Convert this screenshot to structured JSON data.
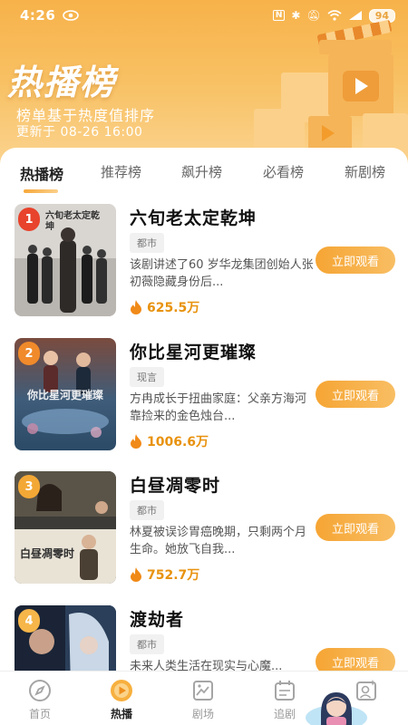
{
  "status_bar": {
    "time": "4:26",
    "battery": "94"
  },
  "header": {
    "title": "热播榜",
    "subtitle": "榜单基于热度值排序",
    "updated": "更新于 08-26 16:00"
  },
  "tabs": [
    {
      "label": "热播榜",
      "active": true
    },
    {
      "label": "推荐榜",
      "active": false
    },
    {
      "label": "飙升榜",
      "active": false
    },
    {
      "label": "必看榜",
      "active": false
    },
    {
      "label": "新剧榜",
      "active": false
    }
  ],
  "items": [
    {
      "rank": "1",
      "title": "六旬老太定乾坤",
      "tag": "都市",
      "desc": "该剧讲述了60 岁华龙集团创始人张初薇隐藏身份后...",
      "heat": "625.5万",
      "button": "立即观看",
      "poster_text": "六旬老太定乾坤",
      "badge_color": "#e8432c"
    },
    {
      "rank": "2",
      "title": "你比星河更璀璨",
      "tag": "现言",
      "desc": "方冉成长于扭曲家庭：父亲方海河靠捡来的金色烛台...",
      "heat": "1006.6万",
      "button": "立即观看",
      "poster_text": "你比星河更璀璨",
      "badge_color": "#f08a2b"
    },
    {
      "rank": "3",
      "title": "白昼凋零时",
      "tag": "都市",
      "desc": "林夏被误诊胃癌晚期，只剩两个月生命。她放飞自我...",
      "heat": "752.7万",
      "button": "立即观看",
      "poster_text": "白昼凋零时",
      "badge_color": "#f3a836"
    },
    {
      "rank": "4",
      "title": "渡劫者",
      "tag": "都市",
      "desc": "未来人类生活在现实与心魔...",
      "heat": "",
      "button": "立即观看",
      "poster_text": "",
      "badge_color": "#f6b64a"
    }
  ],
  "bottom_nav": [
    {
      "label": "首页",
      "icon": "compass-icon",
      "active": false
    },
    {
      "label": "热播",
      "icon": "play-circle-icon",
      "active": true
    },
    {
      "label": "剧场",
      "icon": "theater-icon",
      "active": false
    },
    {
      "label": "追剧",
      "icon": "calendar-icon",
      "active": false
    },
    {
      "label": "",
      "icon": "profile-icon",
      "active": false
    }
  ],
  "colors": {
    "accent": "#f6a534",
    "heat": "#e8920e"
  }
}
